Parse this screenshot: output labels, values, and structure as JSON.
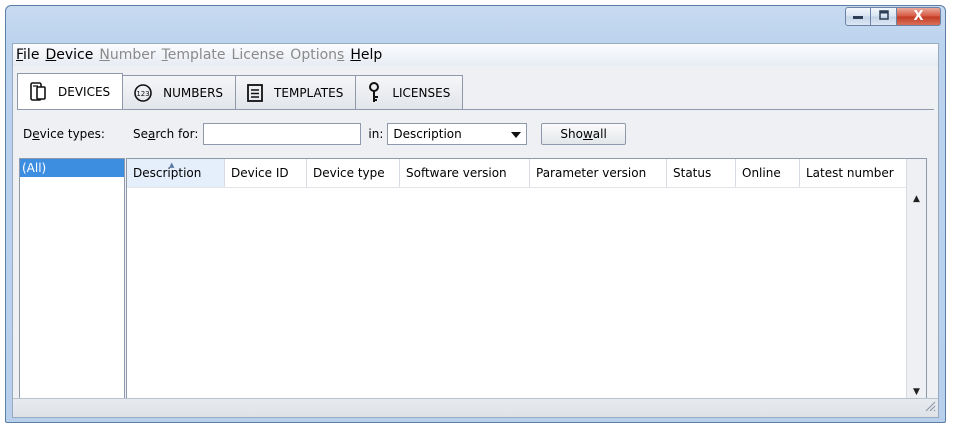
{
  "window": {
    "controls": {
      "minimize_icon": "minimize-icon",
      "maximize_icon": "maximize-icon",
      "close_glyph": "X"
    }
  },
  "menu": [
    {
      "name": "file",
      "mnemonic": "F",
      "rest": "ile",
      "enabled": true
    },
    {
      "name": "device",
      "mnemonic": "D",
      "rest": "evice",
      "enabled": true
    },
    {
      "name": "number",
      "mnemonic": "N",
      "rest": "umber",
      "enabled": false
    },
    {
      "name": "template",
      "mnemonic": "T",
      "rest": "emplate",
      "enabled": false
    },
    {
      "name": "license",
      "mnemonic": "",
      "rest": "License",
      "enabled": false
    },
    {
      "name": "options",
      "pre": "Option",
      "mnemonic": "s",
      "rest": "",
      "enabled": false
    },
    {
      "name": "help",
      "mnemonic": "H",
      "rest": "elp",
      "enabled": true
    }
  ],
  "tabs": [
    {
      "label": "DEVICES",
      "icon": "device-icon",
      "active": true
    },
    {
      "label": "NUMBERS",
      "icon": "numbers-icon",
      "active": false
    },
    {
      "label": "TEMPLATES",
      "icon": "document-icon",
      "active": false
    },
    {
      "label": "LICENSES",
      "icon": "key-icon",
      "active": false
    }
  ],
  "toolbar": {
    "device_types_pre": "D",
    "device_types_mn": "e",
    "device_types_post": "vice types:",
    "search_pre": "Se",
    "search_mn": "a",
    "search_post": "rch for:",
    "search_value": "",
    "in_label": "in:",
    "in_selected": "Description",
    "show_all_pre": "Sho",
    "show_all_mn": "w",
    "show_all_post": " all"
  },
  "device_types": {
    "items": [
      "(All)"
    ]
  },
  "table": {
    "sorted_column": "Description",
    "columns": [
      {
        "label": "Description"
      },
      {
        "label": "Device ID"
      },
      {
        "label": "Device type"
      },
      {
        "label": "Software version"
      },
      {
        "label": "Parameter version"
      },
      {
        "label": "Status"
      },
      {
        "label": "Online"
      },
      {
        "label": "Latest number"
      }
    ],
    "rows": []
  },
  "colors": {
    "selection": "#3d8ee0",
    "close_button": "#c23a22"
  }
}
